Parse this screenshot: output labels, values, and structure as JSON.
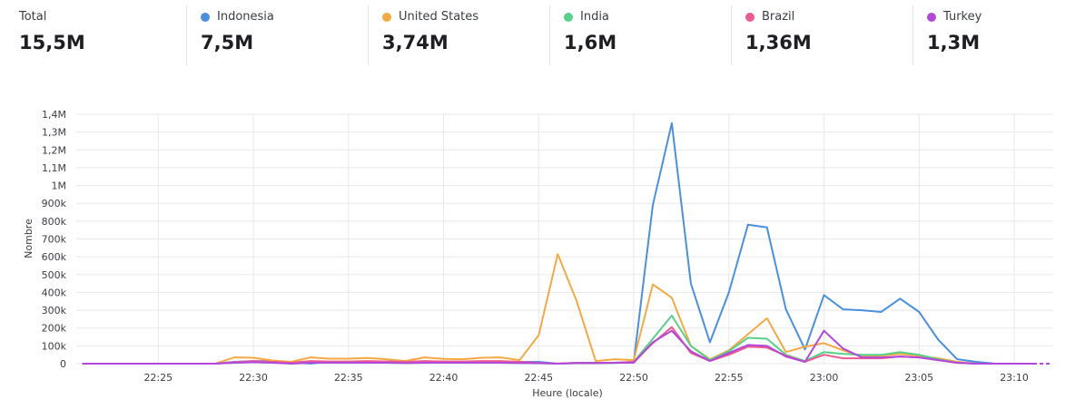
{
  "stats": {
    "total": {
      "label": "Total",
      "value": "15,5M"
    },
    "items": [
      {
        "label": "Indonesia",
        "value": "7,5M",
        "color": "#4a90e2"
      },
      {
        "label": "United States",
        "value": "3,74M",
        "color": "#f5a941"
      },
      {
        "label": "India",
        "value": "1,6M",
        "color": "#57d08a"
      },
      {
        "label": "Brazil",
        "value": "1,36M",
        "color": "#ec5a92"
      },
      {
        "label": "Turkey",
        "value": "1,3M",
        "color": "#b347d9"
      }
    ]
  },
  "chart_data": {
    "type": "line",
    "xlabel": "Heure (locale)",
    "ylabel": "Nombre",
    "xlim": [
      "22:21",
      "22:55.8"
    ],
    "ylim": [
      0,
      1400000
    ],
    "x_ticks": [
      "22:25",
      "22:30",
      "22:35",
      "22:40",
      "22:45",
      "22:50",
      "22:55",
      "23:00",
      "23:05",
      "23:10"
    ],
    "y_ticks": [
      "0",
      "100k",
      "200k",
      "300k",
      "400k",
      "500k",
      "600k",
      "700k",
      "800k",
      "900k",
      "1M",
      "1,1M",
      "1,2M",
      "1,3M",
      "1,4M"
    ],
    "grid": true,
    "x": [
      "22:21",
      "22:22",
      "22:23",
      "22:24",
      "22:25",
      "22:26",
      "22:27",
      "22:28",
      "22:29",
      "22:30",
      "22:31",
      "22:32",
      "22:33",
      "22:34",
      "22:35",
      "22:36",
      "22:37",
      "22:38",
      "22:39",
      "22:40",
      "22:41",
      "22:42",
      "22:43",
      "22:44",
      "22:45",
      "22:46",
      "22:47",
      "22:48",
      "22:49",
      "22:50",
      "22:51",
      "22:52",
      "22:53",
      "22:54",
      "22:55",
      "22:56",
      "22:57",
      "22:58",
      "22:59",
      "23:00",
      "23:01",
      "23:02",
      "23:03",
      "23:04",
      "23:05",
      "23:06",
      "23:07",
      "23:08",
      "23:09",
      "23:10",
      "23:11",
      "23:12"
    ],
    "series": [
      {
        "name": "Indonesia",
        "color": "#4a90e2",
        "values": [
          0,
          0,
          0,
          0,
          0,
          0,
          0,
          0,
          10000,
          15000,
          15000,
          8000,
          0,
          10000,
          10000,
          10000,
          12000,
          10000,
          8000,
          12000,
          10000,
          10000,
          10000,
          10000,
          10000,
          0,
          5000,
          5000,
          5000,
          10000,
          890000,
          1350000,
          450000,
          120000,
          400000,
          780000,
          765000,
          305000,
          80000,
          385000,
          305000,
          300000,
          290000,
          365000,
          290000,
          135000,
          25000,
          10000,
          0,
          0,
          0,
          0
        ]
      },
      {
        "name": "United States",
        "color": "#f5a941",
        "values": [
          0,
          0,
          0,
          0,
          0,
          0,
          0,
          0,
          35000,
          33000,
          18000,
          10000,
          35000,
          28000,
          28000,
          32000,
          25000,
          15000,
          35000,
          27000,
          25000,
          33000,
          35000,
          20000,
          160000,
          615000,
          350000,
          15000,
          25000,
          20000,
          445000,
          370000,
          100000,
          25000,
          75000,
          165000,
          255000,
          65000,
          95000,
          115000,
          75000,
          40000,
          45000,
          55000,
          45000,
          30000,
          10000,
          0,
          0,
          0,
          0,
          0
        ]
      },
      {
        "name": "India",
        "color": "#57d08a",
        "values": [
          0,
          0,
          0,
          0,
          0,
          0,
          0,
          0,
          5000,
          8000,
          5000,
          3000,
          5000,
          5000,
          5000,
          5000,
          5000,
          3000,
          5000,
          5000,
          5000,
          5000,
          5000,
          3000,
          2000,
          0,
          2000,
          2000,
          3000,
          10000,
          140000,
          270000,
          100000,
          20000,
          70000,
          145000,
          140000,
          50000,
          15000,
          65000,
          55000,
          50000,
          50000,
          65000,
          50000,
          25000,
          5000,
          0,
          0,
          0,
          0,
          0
        ]
      },
      {
        "name": "Brazil",
        "color": "#ec5a92",
        "values": [
          0,
          0,
          0,
          0,
          0,
          0,
          0,
          0,
          8000,
          15000,
          10000,
          5000,
          15000,
          12000,
          12000,
          15000,
          12000,
          10000,
          15000,
          12000,
          12000,
          15000,
          15000,
          10000,
          5000,
          0,
          5000,
          3000,
          5000,
          10000,
          115000,
          205000,
          60000,
          15000,
          50000,
          95000,
          90000,
          45000,
          10000,
          50000,
          30000,
          30000,
          30000,
          40000,
          35000,
          20000,
          5000,
          0,
          0,
          0,
          0,
          0
        ]
      },
      {
        "name": "Turkey",
        "color": "#b347d9",
        "values": [
          0,
          0,
          0,
          0,
          0,
          0,
          0,
          0,
          5000,
          8000,
          5000,
          0,
          5000,
          5000,
          5000,
          5000,
          5000,
          3000,
          5000,
          5000,
          5000,
          5000,
          5000,
          3000,
          3000,
          0,
          3000,
          3000,
          5000,
          5000,
          120000,
          185000,
          70000,
          15000,
          60000,
          105000,
          100000,
          40000,
          10000,
          185000,
          85000,
          35000,
          35000,
          40000,
          35000,
          20000,
          5000,
          0,
          0,
          0,
          0,
          0
        ]
      }
    ]
  }
}
